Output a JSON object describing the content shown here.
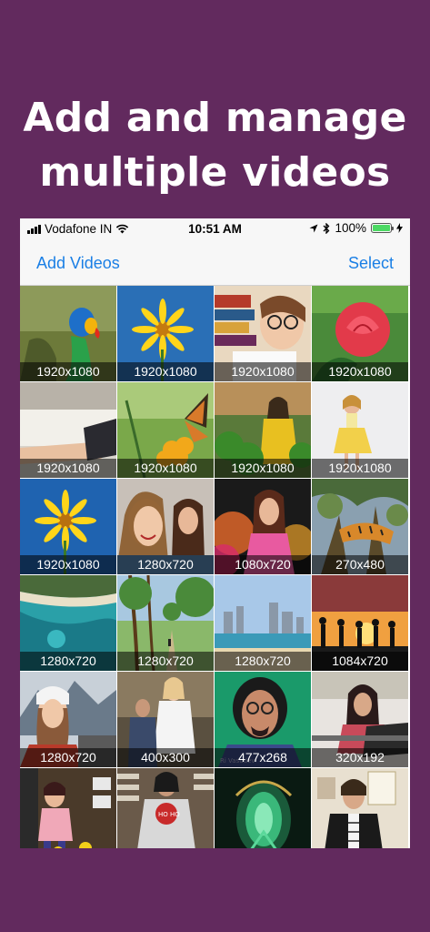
{
  "headline": {
    "line1": "Add and manage",
    "line2": "multiple videos"
  },
  "status_bar": {
    "carrier": "Vodafone IN",
    "time": "10:51 AM",
    "battery": "100%",
    "battery_level": 1.0
  },
  "nav": {
    "left_label": "Add Videos",
    "right_label": "Select"
  },
  "videos": [
    {
      "resolution": "1920x1080",
      "subject": "parrot"
    },
    {
      "resolution": "1920x1080",
      "subject": "yellow flower"
    },
    {
      "resolution": "1920x1080",
      "subject": "child reading books"
    },
    {
      "resolution": "1920x1080",
      "subject": "red rose"
    },
    {
      "resolution": "1920x1080",
      "subject": "person resting"
    },
    {
      "resolution": "1920x1080",
      "subject": "butterfly on flower"
    },
    {
      "resolution": "1920x1080",
      "subject": "woman in garden"
    },
    {
      "resolution": "1920x1080",
      "subject": "girl in yellow dress"
    },
    {
      "resolution": "1920x1080",
      "subject": "yellow flower blue sky"
    },
    {
      "resolution": "1280x720",
      "subject": "smiling women"
    },
    {
      "resolution": "1080x720",
      "subject": "woman with colored smoke"
    },
    {
      "resolution": "270x480",
      "subject": "tiger on tree"
    },
    {
      "resolution": "1280x720",
      "subject": "aerial coastline"
    },
    {
      "resolution": "1280x720",
      "subject": "park path"
    },
    {
      "resolution": "1280x720",
      "subject": "city beach"
    },
    {
      "resolution": "1084x720",
      "subject": "sunset silhouettes"
    },
    {
      "resolution": "1280x720",
      "subject": "woman mountains"
    },
    {
      "resolution": "400x300",
      "subject": "people in room"
    },
    {
      "resolution": "477x268",
      "subject": "man with glasses"
    },
    {
      "resolution": "320x192",
      "subject": "woman at desk"
    },
    {
      "resolution": "",
      "subject": "children"
    },
    {
      "resolution": "",
      "subject": "woman in store"
    },
    {
      "resolution": "",
      "subject": "green ornament"
    },
    {
      "resolution": "",
      "subject": "woman in office"
    }
  ],
  "colors": {
    "background": "#622a5e",
    "accent": "#1a7fe5",
    "battery": "#4cd964"
  }
}
